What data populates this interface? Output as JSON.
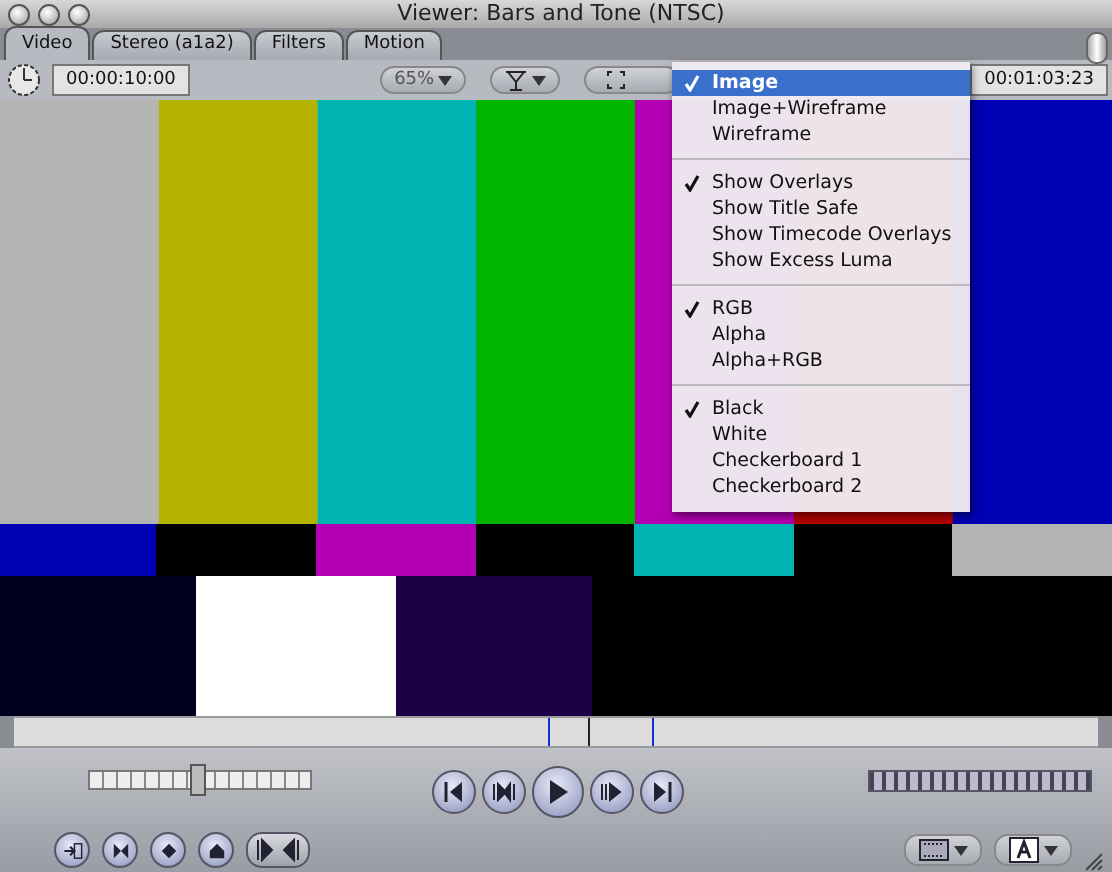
{
  "window": {
    "title": "Viewer: Bars and Tone (NTSC)"
  },
  "tabs": [
    {
      "label": "Video",
      "selected": true
    },
    {
      "label": "Stereo (a1a2)",
      "selected": false
    },
    {
      "label": "Filters",
      "selected": false
    },
    {
      "label": "Motion",
      "selected": false
    }
  ],
  "toolbar": {
    "duration": "00:00:10:00",
    "zoom": "65%",
    "current_timecode": "00:01:03:23"
  },
  "view_menu": {
    "sections": [
      [
        {
          "label": "Image",
          "checked": true,
          "selected": true
        },
        {
          "label": "Image+Wireframe",
          "checked": false,
          "selected": false
        },
        {
          "label": "Wireframe",
          "checked": false,
          "selected": false
        }
      ],
      [
        {
          "label": "Show Overlays",
          "checked": true,
          "selected": false
        },
        {
          "label": "Show Title Safe",
          "checked": false,
          "selected": false
        },
        {
          "label": "Show Timecode Overlays",
          "checked": false,
          "selected": false
        },
        {
          "label": "Show Excess Luma",
          "checked": false,
          "selected": false
        }
      ],
      [
        {
          "label": "RGB",
          "checked": true,
          "selected": false
        },
        {
          "label": "Alpha",
          "checked": false,
          "selected": false
        },
        {
          "label": "Alpha+RGB",
          "checked": false,
          "selected": false
        }
      ],
      [
        {
          "label": "Black",
          "checked": true,
          "selected": false
        },
        {
          "label": "White",
          "checked": false,
          "selected": false
        },
        {
          "label": "Checkerboard 1",
          "checked": false,
          "selected": false
        },
        {
          "label": "Checkerboard 2",
          "checked": false,
          "selected": false
        }
      ]
    ]
  },
  "scrubber": {
    "level": 0.53
  },
  "shuttle": {
    "level": 0.48
  }
}
